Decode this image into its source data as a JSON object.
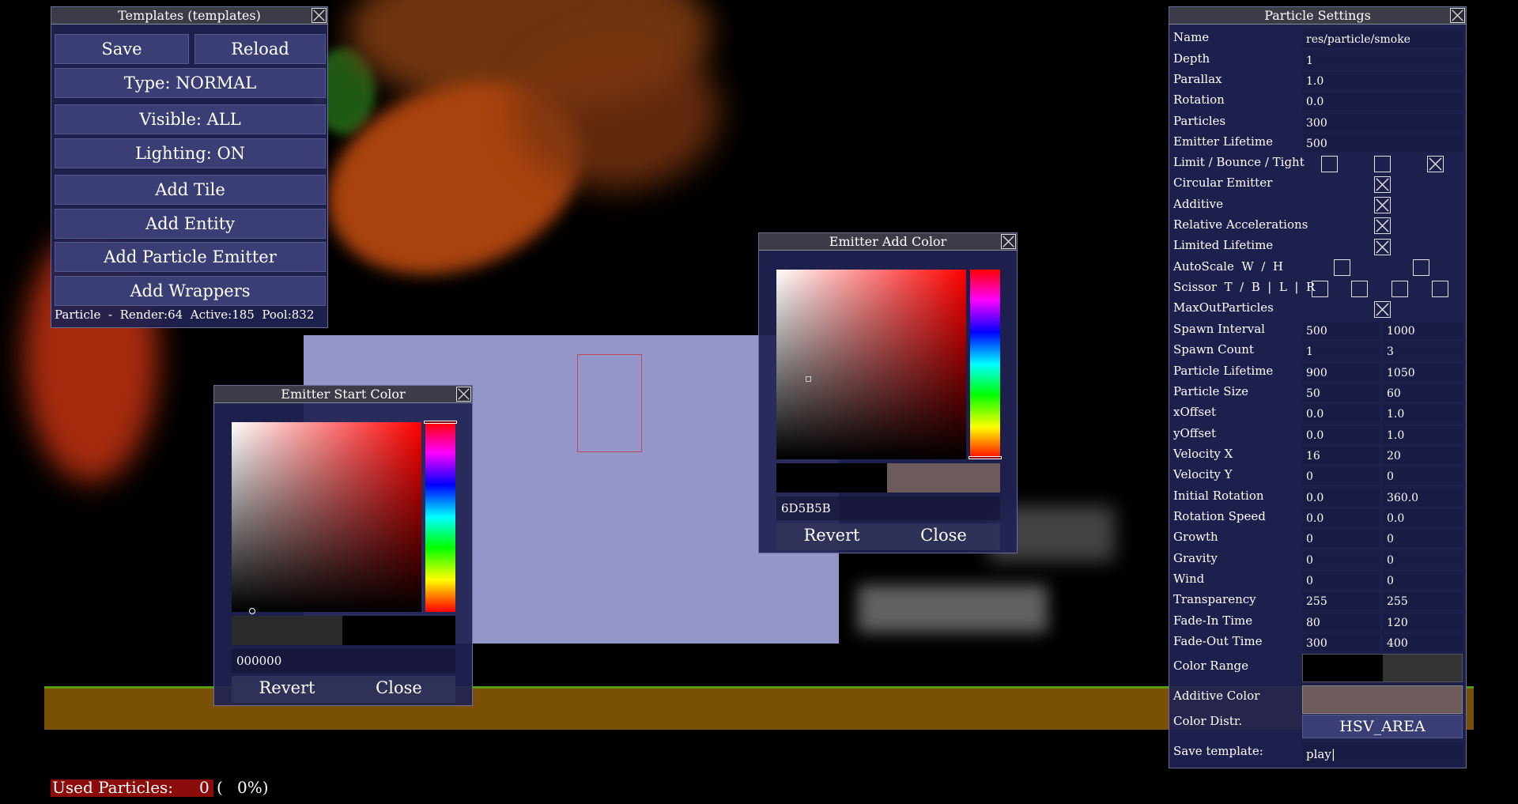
{
  "templates_window": {
    "title": "Templates (templates)",
    "save": "Save",
    "reload": "Reload",
    "type": "Type: NORMAL",
    "visible": "Visible: ALL",
    "lighting": "Lighting: ON",
    "add_tile": "Add Tile",
    "add_entity": "Add Entity",
    "add_particle_emitter": "Add Particle Emitter",
    "add_wrappers": "Add Wrappers",
    "status": "Particle  -  Render:64  Active:185  Pool:832"
  },
  "start_color": {
    "title": "Emitter Start Color",
    "hex": "000000",
    "preview_new": "#2a2a2a",
    "preview_old": "#000000",
    "revert": "Revert",
    "close": "Close"
  },
  "add_color": {
    "title": "Emitter Add Color",
    "hex": "6D5B5B",
    "preview_new": "#000000",
    "preview_old": "#6d5b5b",
    "revert": "Revert",
    "close": "Close"
  },
  "settings": {
    "title": "Particle Settings",
    "name_label": "Name",
    "name_value": "res/particle/smoke",
    "depth_label": "Depth",
    "depth_value": "1",
    "parallax_label": "Parallax",
    "parallax_value": "1.0",
    "rotation_label": "Rotation",
    "rotation_value": "0.0",
    "particles_label": "Particles",
    "particles_value": "300",
    "emitter_lifetime_label": "Emitter Lifetime",
    "emitter_lifetime_value": "500",
    "limit_label": "Limit / Bounce / Tight",
    "limit_checked": [
      false,
      false,
      true
    ],
    "circular_label": "Circular Emitter",
    "circular_checked": true,
    "additive_label": "Additive",
    "additive_checked": true,
    "relacc_label": "Relative Accelerations",
    "relacc_checked": true,
    "limlife_label": "Limited Lifetime",
    "limlife_checked": true,
    "autoscale_label": "AutoScale  W  /  H",
    "scissor_label": "Scissor  T  /  B  |  L  |  R",
    "maxout_label": "MaxOutParticles",
    "maxout_checked": true,
    "rows": [
      {
        "label": "Spawn Interval",
        "min": "500",
        "max": "1000"
      },
      {
        "label": "Spawn Count",
        "min": "1",
        "max": "3"
      },
      {
        "label": "Particle Lifetime",
        "min": "900",
        "max": "1050"
      },
      {
        "label": "Particle Size",
        "min": "50",
        "max": "60"
      },
      {
        "label": "xOffset",
        "min": "0.0",
        "max": "1.0"
      },
      {
        "label": "yOffset",
        "min": "0.0",
        "max": "1.0"
      },
      {
        "label": "Velocity X",
        "min": "16",
        "max": "20"
      },
      {
        "label": "Velocity Y",
        "min": "0",
        "max": "0"
      },
      {
        "label": "Initial Rotation",
        "min": "0.0",
        "max": "360.0"
      },
      {
        "label": "Rotation Speed",
        "min": "0.0",
        "max": "0.0"
      },
      {
        "label": "Growth",
        "min": "0",
        "max": "0"
      },
      {
        "label": "Gravity",
        "min": "0",
        "max": "0"
      },
      {
        "label": "Wind",
        "min": "0",
        "max": "0"
      },
      {
        "label": "Transparency",
        "min": "255",
        "max": "255"
      },
      {
        "label": "Fade-In Time",
        "min": "80",
        "max": "120"
      },
      {
        "label": "Fade-Out Time",
        "min": "300",
        "max": "400"
      }
    ],
    "color_range_label": "Color Range",
    "color_range_start": "#000000",
    "color_range_end": "#333333",
    "additive_color_label": "Additive Color",
    "additive_color": "#6d5b5b",
    "color_distr_label": "Color Distr.",
    "color_distr_value": "HSV_AREA",
    "save_template_label": "Save template:",
    "save_template_value": "play|"
  },
  "used_particles": {
    "label": "Used Particles:",
    "count": "0",
    "paren": "(",
    "percent": "0%)"
  }
}
